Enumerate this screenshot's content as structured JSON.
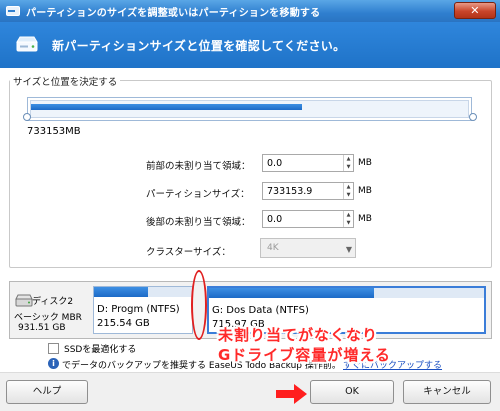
{
  "window": {
    "title": "パーティションのサイズを調整或いはパーティションを移動する",
    "close_label": "✕"
  },
  "banner": {
    "title": "新パーティションサイズと位置を確認してください。"
  },
  "group": {
    "legend": "サイズと位置を決定する",
    "bar_fill_fraction": 0.62,
    "size_text": "733153MB",
    "rows": [
      {
        "label": "前部の未割り当て領域：",
        "value": "0.0",
        "unit": "MB"
      },
      {
        "label": "パーティションサイズ：",
        "value": "733153.9",
        "unit": "MB"
      },
      {
        "label": "後部の未割り当て領域：",
        "value": "0.0",
        "unit": "MB"
      }
    ],
    "cluster_label": "クラスターサイズ：",
    "cluster_value": "4K"
  },
  "disk": {
    "name": "ディスク2",
    "type": "ベーシック MBR",
    "size": "931.51 GB",
    "partitions": [
      {
        "name": "D: Progm (NTFS)",
        "size": "215.54 GB",
        "fill_fraction": 0.55
      },
      {
        "name": "G: Dos Data (NTFS)",
        "size": "715.97 GB",
        "fill_fraction": 0.6
      }
    ]
  },
  "options": {
    "ssd_label": "SSDを最適化する",
    "info_text": "でデータのバックアップを推奨する EaseUS Todo Backup 操作前。",
    "info_link": "すぐにバックアップする"
  },
  "footer": {
    "help_label": "ヘルプ",
    "ok_label": "OK",
    "cancel_label": "キャンセル"
  },
  "annotation": {
    "line1": "未割り当てがなくなり",
    "line2": "Gドライブ容量が増える",
    "color": "#ff2a2a"
  }
}
